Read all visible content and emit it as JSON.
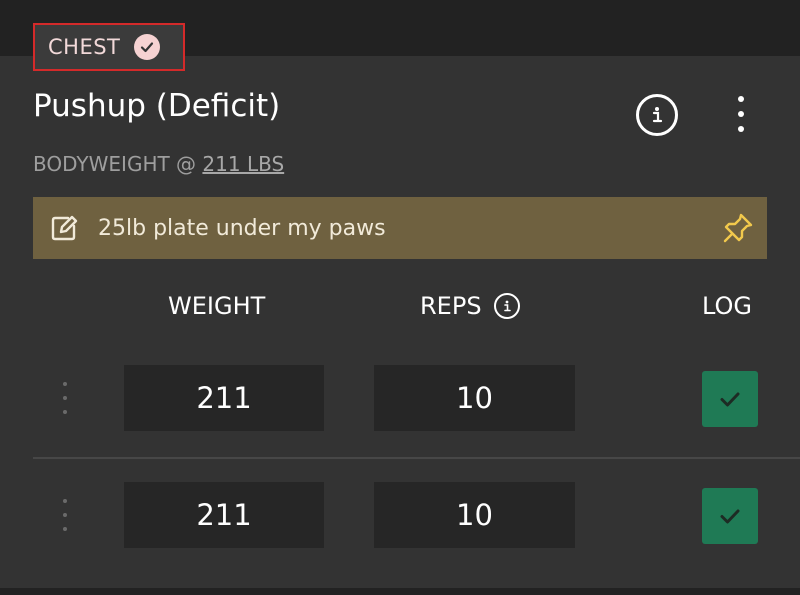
{
  "exercise": {
    "muscle_group": "CHEST",
    "muscle_group_icon": "check-circle-icon",
    "title": "Pushup (Deficit)",
    "subtitle_prefix": "BODYWEIGHT @",
    "bodyweight": "211 LBS",
    "note": "25lb plate under my paws",
    "note_icon": "edit-note-icon",
    "pin_icon": "pin-icon",
    "info_icon": "info-icon",
    "more_icon": "more-vertical-icon"
  },
  "columns": {
    "weight": "WEIGHT",
    "reps": "REPS",
    "log": "LOG"
  },
  "sets": [
    {
      "weight": "211",
      "reps": "10",
      "logged": true
    },
    {
      "weight": "211",
      "reps": "10",
      "logged": true
    }
  ],
  "colors": {
    "background": "#222222",
    "card": "#333333",
    "note_bar": "#6f6140",
    "log_green": "#1f7a55",
    "badge_border": "#d42a2a"
  }
}
